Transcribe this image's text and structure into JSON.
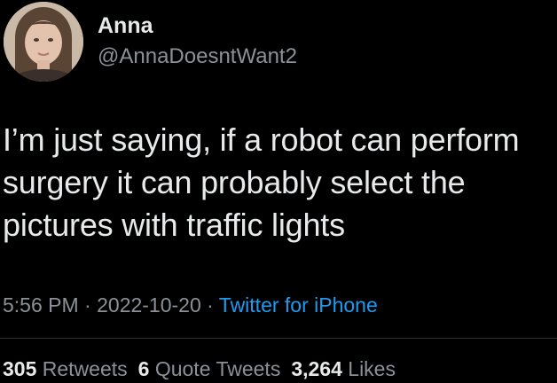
{
  "author": {
    "name": "Anna",
    "handle": "@AnnaDoesntWant2"
  },
  "tweet": {
    "text": "I’m just saying, if a robot can perform surgery it can probably select the pictures with traffic lights",
    "time": "5:56 PM",
    "separator": " · ",
    "date": "2022-10-20",
    "source": "Twitter for iPhone"
  },
  "stats": {
    "retweets_count": "305",
    "retweets_label": " Retweets",
    "quotes_count": "6",
    "quotes_label": " Quote Tweets",
    "likes_count": "3,264",
    "likes_label": " Likes"
  },
  "colors": {
    "background": "#000000",
    "text": "#e7e9ea",
    "secondary": "#8b9197",
    "link": "#1d9bf0"
  }
}
